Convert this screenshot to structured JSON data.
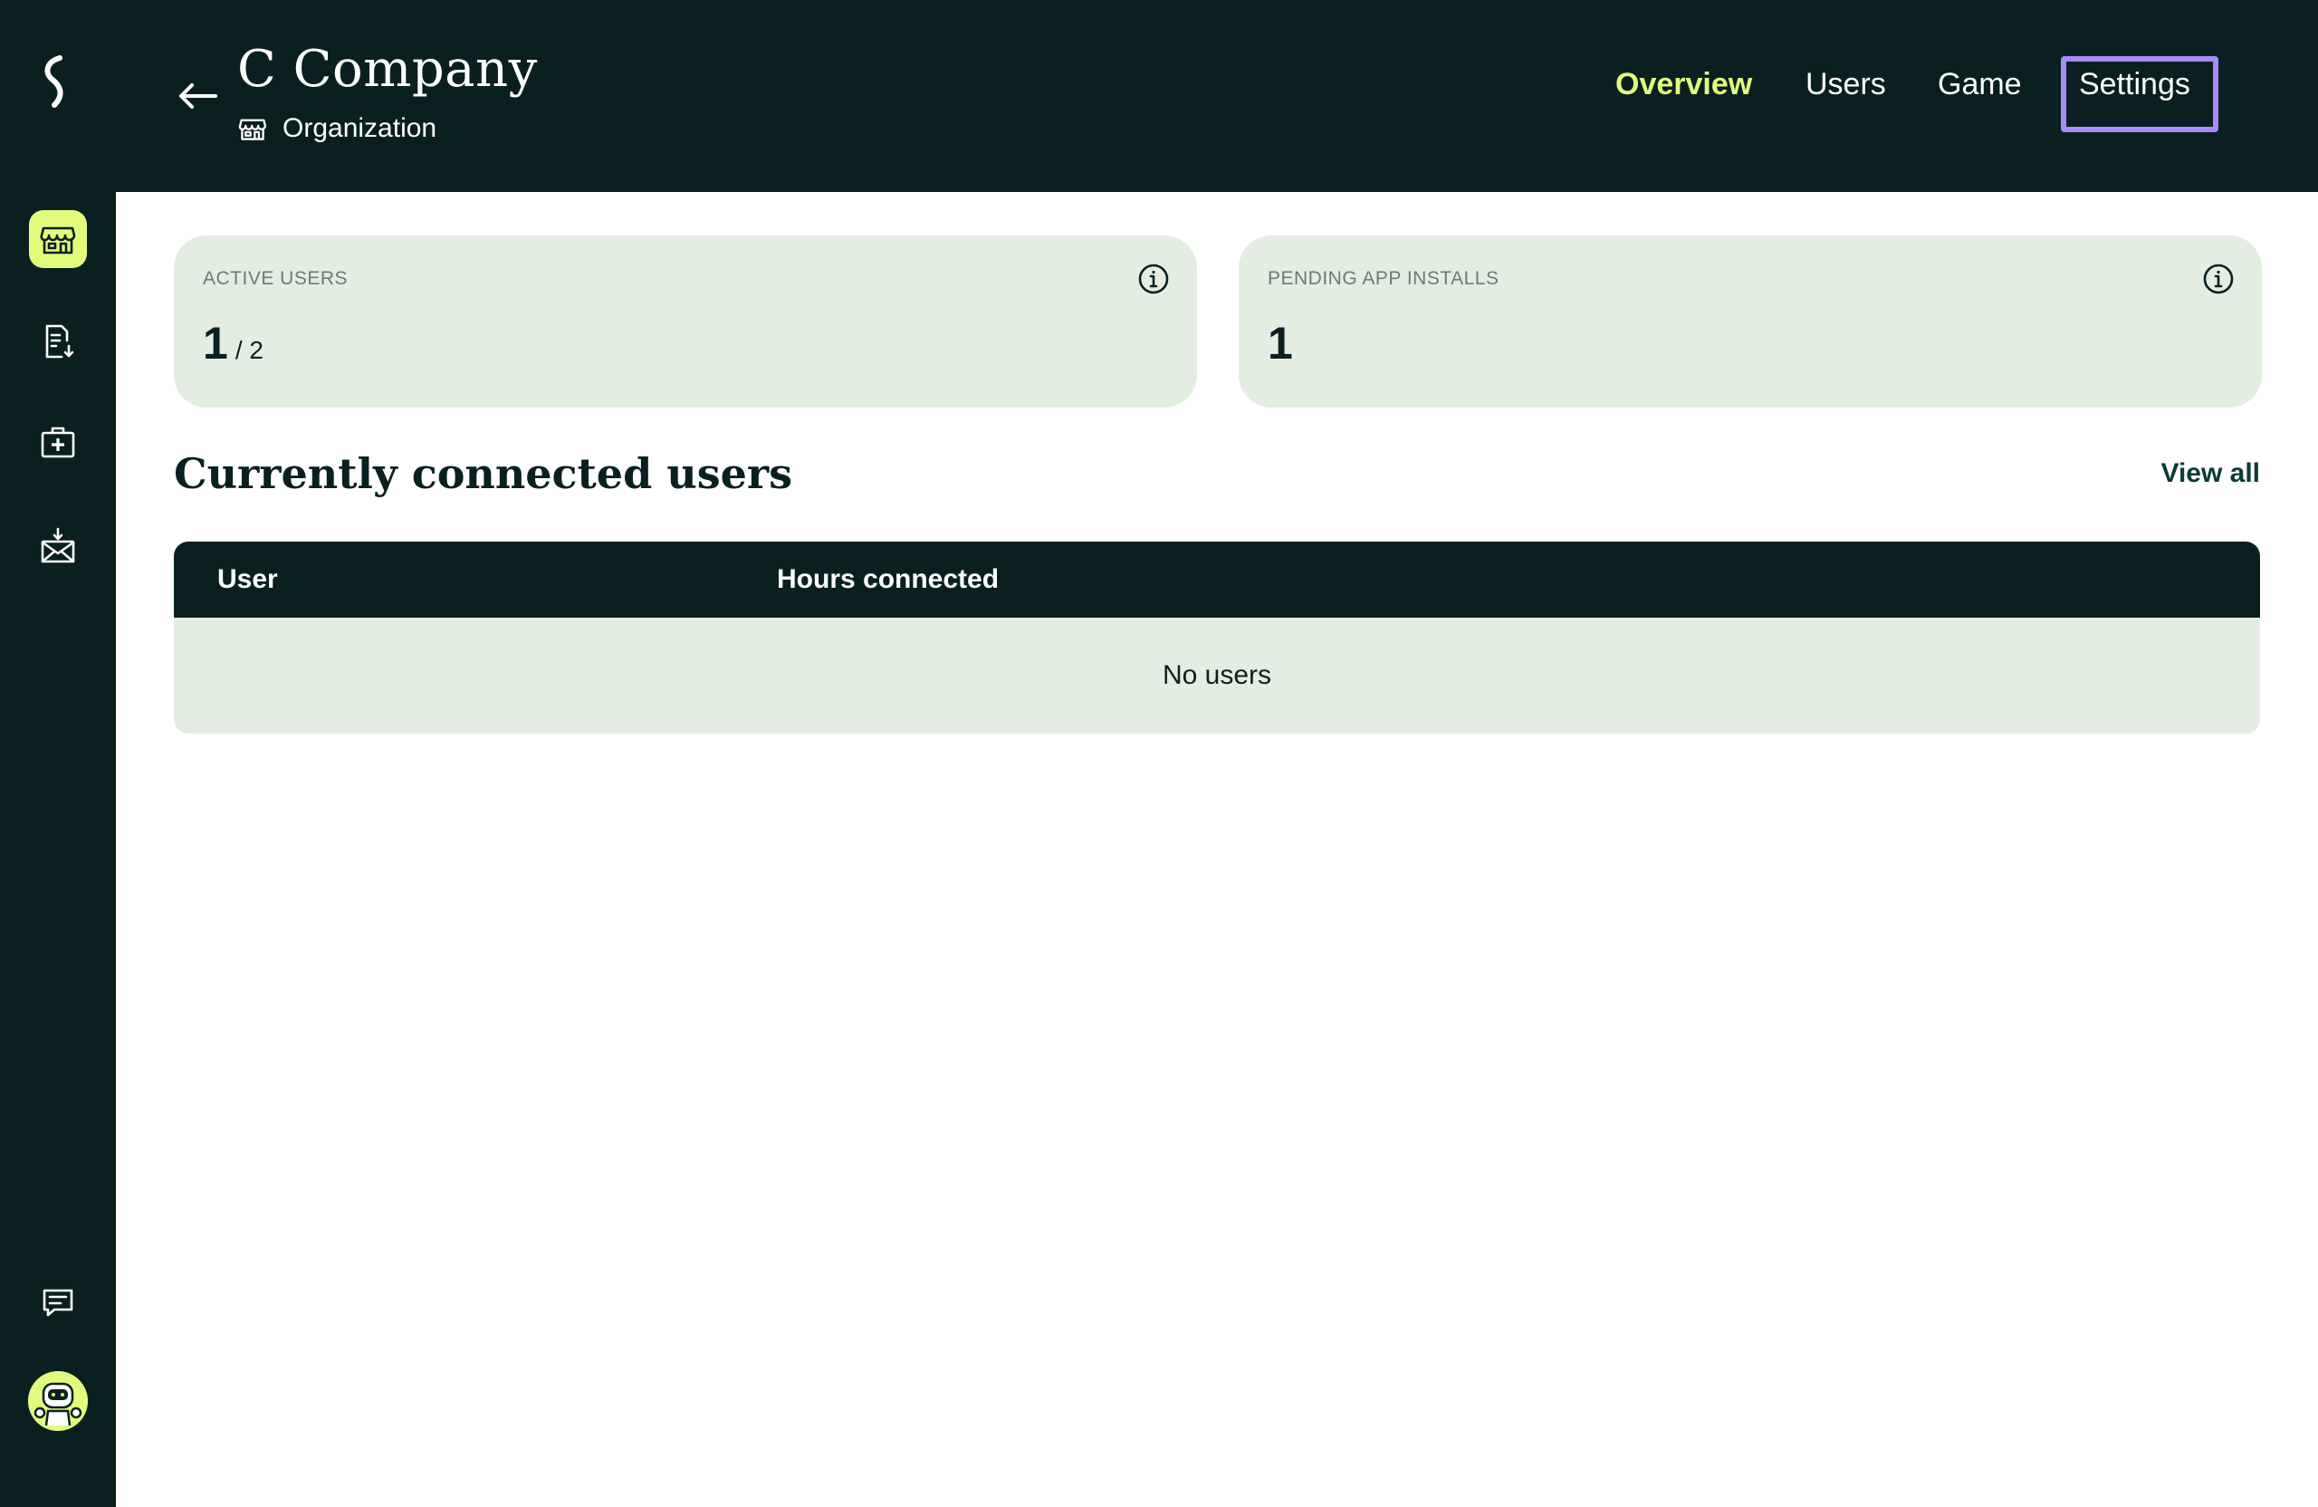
{
  "header": {
    "title": "C Company",
    "subtitle": "Organization"
  },
  "tabs": [
    {
      "label": "Overview",
      "active": true
    },
    {
      "label": "Users",
      "active": false
    },
    {
      "label": "Game",
      "active": false
    },
    {
      "label": "Settings",
      "active": false,
      "highlighted": true
    }
  ],
  "sidebar": {
    "items": [
      {
        "icon": "storefront-icon",
        "active": true
      },
      {
        "icon": "document-download-icon",
        "active": false
      },
      {
        "icon": "medical-kit-icon",
        "active": false
      },
      {
        "icon": "mail-inbox-icon",
        "active": false
      }
    ],
    "bottom": [
      {
        "icon": "chat-icon"
      },
      {
        "icon": "robot-avatar-icon"
      }
    ]
  },
  "stats": {
    "active_users": {
      "label": "ACTIVE USERS",
      "value": "1",
      "total": "/ 2"
    },
    "pending_installs": {
      "label": "PENDING APP INSTALLS",
      "value": "1"
    }
  },
  "section": {
    "title": "Currently connected users",
    "view_all": "View all"
  },
  "table": {
    "columns": [
      "User",
      "Hours connected"
    ],
    "empty_text": "No users"
  },
  "colors": {
    "dark": "#0a2020",
    "accent": "#e2fb7c",
    "card": "#e4ede2",
    "highlight": "#a78bfa"
  }
}
